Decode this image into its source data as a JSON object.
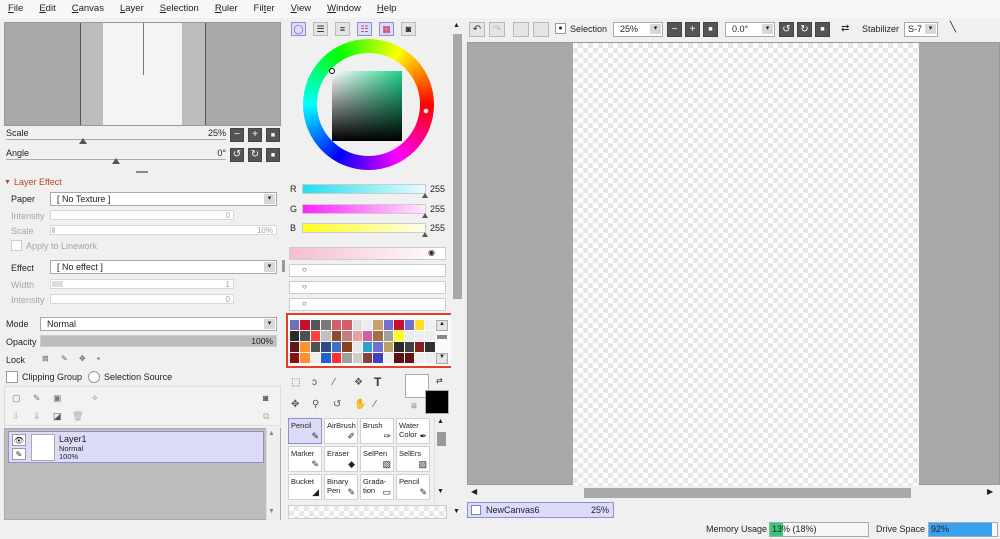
{
  "menu": [
    {
      "pre": "",
      "u": "F",
      "post": "ile"
    },
    {
      "pre": "",
      "u": "E",
      "post": "dit"
    },
    {
      "pre": "",
      "u": "C",
      "post": "anvas"
    },
    {
      "pre": "",
      "u": "L",
      "post": "ayer"
    },
    {
      "pre": "",
      "u": "S",
      "post": "election"
    },
    {
      "pre": "",
      "u": "R",
      "post": "uler"
    },
    {
      "pre": "Fil",
      "u": "t",
      "post": "er"
    },
    {
      "pre": "",
      "u": "V",
      "post": "iew"
    },
    {
      "pre": "",
      "u": "W",
      "post": "indow"
    },
    {
      "pre": "",
      "u": "H",
      "post": "elp"
    }
  ],
  "navigator": {
    "scale_label": "Scale",
    "scale_value": "25%",
    "angle_label": "Angle",
    "angle_value": "0°",
    "scale_level": 0.25
  },
  "layer_effect": {
    "header": "Layer Effect",
    "paper_label": "Paper",
    "paper_value": "[ No Texture ]",
    "intensity_label": "Intensity",
    "intensity_value": "0",
    "scale_label": "Scale",
    "scale_value": "10%",
    "apply_linework": "Apply to Linework",
    "effect_label": "Effect",
    "effect_value": "[ No effect ]",
    "width_label": "Width",
    "width_value": "1",
    "intensity2_label": "Intensity",
    "intensity2_value": "0"
  },
  "layer_props": {
    "mode_label": "Mode",
    "mode_value": "Normal",
    "opacity_label": "Opacity",
    "opacity_value": "100%",
    "lock_label": "Lock",
    "clipping_group": "Clipping Group",
    "selection_source": "Selection Source",
    "opacity_level": 1.0
  },
  "layers": [
    {
      "name": "Layer1",
      "mode": "Normal",
      "opacity": "100%"
    }
  ],
  "color": {
    "r_label": "R",
    "r_value": "255",
    "g_label": "G",
    "g_value": "255",
    "b_label": "B",
    "b_value": "255",
    "r_color": "#22e0f0",
    "g_color": "#ff20ff",
    "b_color": "#ffff20"
  },
  "swatches": [
    [
      "#6f6fb8",
      "#c8102e",
      "#555555",
      "#7a7a7a",
      "#d06070",
      "#d06070",
      "#e0e0e0",
      "#ececec",
      "#c8a070",
      "#7070d0",
      "#c8102e",
      "#7070d0",
      "#ffe020",
      "#eeeeee"
    ],
    [
      "#2a2a2a",
      "#505050",
      "#ff4040",
      "#c0c0c0",
      "#8a4a30",
      "#c08080",
      "#e8a0a0",
      "#d060a0",
      "#a07040",
      "#a0a0a0",
      "#ffff20",
      "#ececec",
      "#eeeeee",
      "#eeeeee"
    ],
    [
      "#5a1a1a",
      "#ff9030",
      "#505050",
      "#2a4a8a",
      "#4070c0",
      "#8a4020",
      "#e8e8e8",
      "#30a0d0",
      "#7070d0",
      "#c0a060",
      "#2a2a2a",
      "#404040",
      "#8a2020",
      "#303030"
    ],
    [
      "#8a1010",
      "#ff9030",
      "#eeeeee",
      "#2060d0",
      "#ff3030",
      "#a0a0a0",
      "#cccccc",
      "#8a4040",
      "#4040c0",
      "#eeeeee",
      "#5a1010",
      "#6a1010",
      "#eeeeee",
      "#eeeeee"
    ]
  ],
  "tools": [
    {
      "name": "Pencil",
      "icon": "pencil-icon",
      "glyph": "✎"
    },
    {
      "name": "AirBrush",
      "icon": "airbrush-icon",
      "glyph": "✐"
    },
    {
      "name": "Brush",
      "icon": "brush-icon",
      "glyph": "✑"
    },
    {
      "name": "Water Color",
      "icon": "watercolor-icon",
      "glyph": "✒"
    },
    {
      "name": "Marker",
      "icon": "marker-icon",
      "glyph": "✎"
    },
    {
      "name": "Eraser",
      "icon": "eraser-icon",
      "glyph": "◆"
    },
    {
      "name": "SelPen",
      "icon": "selpen-icon",
      "glyph": "▧"
    },
    {
      "name": "SelErs",
      "icon": "selers-icon",
      "glyph": "▨"
    },
    {
      "name": "Bucket",
      "icon": "bucket-icon",
      "glyph": "◢"
    },
    {
      "name": "Binary Pen",
      "icon": "binary-pen-icon",
      "glyph": "✎"
    },
    {
      "name": "Grada-tion",
      "icon": "gradation-icon",
      "glyph": "▭"
    },
    {
      "name": "Pencil",
      "icon": "pencil-icon",
      "glyph": "✎"
    }
  ],
  "toolbar": {
    "selection_label": "Selection",
    "zoom_value": "25%",
    "angle_value": "0.0°",
    "stabilizer_label": "Stabilizer",
    "stabilizer_value": "S-7"
  },
  "canvas_tab": {
    "name": "NewCanvas6",
    "zoom": "25%"
  },
  "status": {
    "memory_label": "Memory Usage",
    "memory_value": "13% (18%)",
    "memory_level": 0.13,
    "drive_label": "Drive Space",
    "drive_value": "92%",
    "drive_level": 0.92
  }
}
